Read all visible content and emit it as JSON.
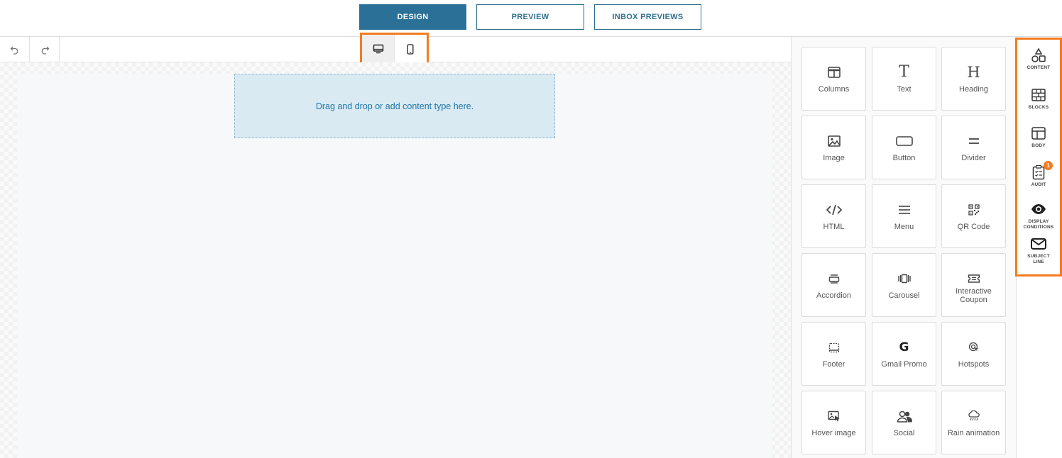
{
  "tabs": [
    {
      "label": "DESIGN",
      "active": true
    },
    {
      "label": "PREVIEW",
      "active": false
    },
    {
      "label": "INBOX PREVIEWS",
      "active": false
    }
  ],
  "toolbar": {
    "undo_icon": "undo-icon",
    "redo_icon": "redo-icon",
    "devices": [
      {
        "icon": "desktop-icon",
        "active": true
      },
      {
        "icon": "mobile-icon",
        "active": false
      }
    ]
  },
  "canvas": {
    "dropzone_text": "Drag and drop or add content type here."
  },
  "content_tiles": [
    {
      "label": "Columns",
      "icon": "columns-icon"
    },
    {
      "label": "Text",
      "icon": "text-icon"
    },
    {
      "label": "Heading",
      "icon": "heading-icon"
    },
    {
      "label": "Image",
      "icon": "image-icon"
    },
    {
      "label": "Button",
      "icon": "button-icon"
    },
    {
      "label": "Divider",
      "icon": "divider-icon"
    },
    {
      "label": "HTML",
      "icon": "html-icon"
    },
    {
      "label": "Menu",
      "icon": "menu-icon"
    },
    {
      "label": "QR Code",
      "icon": "qr-code-icon"
    },
    {
      "label": "Accordion",
      "icon": "accordion-icon"
    },
    {
      "label": "Carousel",
      "icon": "carousel-icon"
    },
    {
      "label": "Interactive Coupon",
      "icon": "coupon-icon"
    },
    {
      "label": "Footer",
      "icon": "footer-icon"
    },
    {
      "label": "Gmail Promo",
      "icon": "google-icon"
    },
    {
      "label": "Hotspots",
      "icon": "hotspots-icon"
    },
    {
      "label": "Hover image",
      "icon": "hover-image-icon"
    },
    {
      "label": "Social",
      "icon": "social-icon"
    },
    {
      "label": "Rain animation",
      "icon": "rain-icon"
    }
  ],
  "rail": [
    {
      "label": "CONTENT",
      "icon": "shapes-icon"
    },
    {
      "label": "BLOCKS",
      "icon": "blocks-icon"
    },
    {
      "label": "BODY",
      "icon": "layout-icon"
    },
    {
      "label": "AUDIT",
      "icon": "clipboard-icon",
      "badge": "1"
    },
    {
      "label": "DISPLAY CONDITIONS",
      "icon": "eye-icon"
    },
    {
      "label": "SUBJECT LINE",
      "icon": "envelope-icon"
    }
  ],
  "colors": {
    "accent": "#2b7096",
    "highlight": "#f47b20",
    "dropzone": "#d9eaf3"
  }
}
